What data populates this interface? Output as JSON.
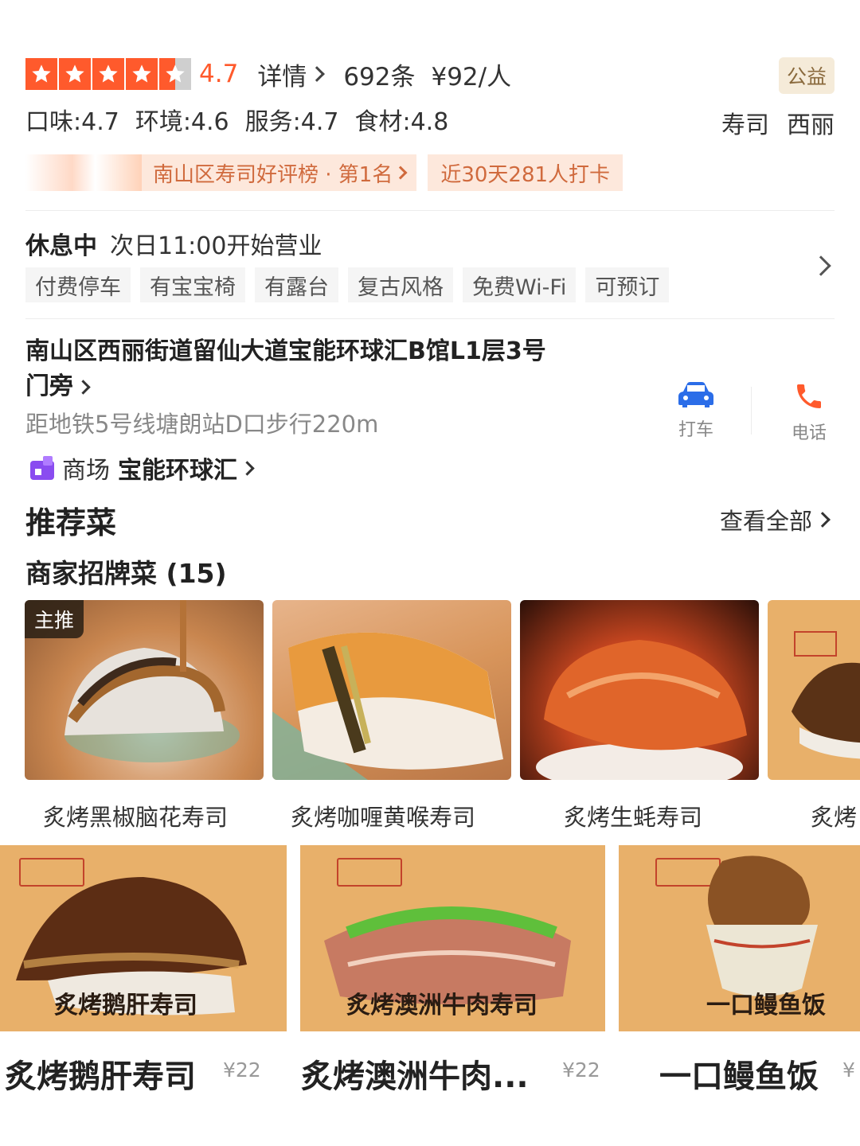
{
  "rating": {
    "score": "4.7",
    "detail_label": "详情",
    "review_count": "692条",
    "price_per_person": "¥92/人",
    "charity_badge": "公益"
  },
  "sub_scores": {
    "taste": "口味:4.7",
    "environment": "环境:4.6",
    "service": "服务:4.7",
    "ingredients": "食材:4.8"
  },
  "cuisine": "寿司",
  "area": "西丽",
  "ranking": {
    "label": "南山区寿司好评榜 · 第1名",
    "checkins": "近30天281人打卡"
  },
  "hours": {
    "status": "休息中",
    "next_open": "次日11:00开始营业"
  },
  "facility_tags": [
    "付费停车",
    "有宝宝椅",
    "有露台",
    "复古风格",
    "免费Wi-Fi",
    "可预订"
  ],
  "address": {
    "line1": "南山区西丽街道留仙大道宝能环球汇B馆L1层3号",
    "line2": "门旁",
    "metro": "距地铁5号线塘朗站D口步行220m"
  },
  "actions": {
    "taxi": "打车",
    "phone": "电话"
  },
  "mall": {
    "label": "商场",
    "name": "宝能环球汇"
  },
  "recommended": {
    "title": "推荐菜",
    "view_all": "查看全部",
    "signature_title": "商家招牌菜 (15)",
    "main_tag": "主推",
    "dishes": [
      "炙烤黑椒脑花寿司",
      "炙烤咖喱黄喉寿司",
      "炙烤生蚝寿司",
      "炙烤"
    ]
  },
  "posters": [
    {
      "caption": "炙烤鹅肝寿司",
      "name": "炙烤鹅肝寿司",
      "price": "¥22"
    },
    {
      "caption": "炙烤澳洲牛肉寿司",
      "name": "炙烤澳洲牛肉...",
      "price": "¥22"
    },
    {
      "caption": "一口鳗鱼饭",
      "name": "一口鳗鱼饭",
      "price": "¥"
    }
  ],
  "colors": {
    "accent_orange": "#ff5a2c",
    "rank_bg": "#fde8dc",
    "rank_text": "#d06a3d",
    "taxi_blue": "#2b6de8",
    "phone_orange": "#ff5a2c",
    "poster_bg": "#e8b06a"
  }
}
